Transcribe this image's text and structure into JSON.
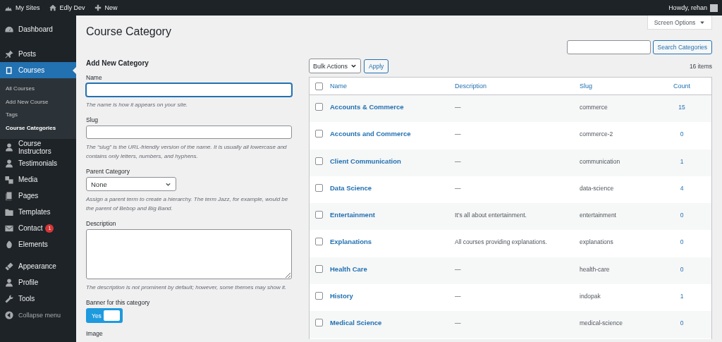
{
  "admin_bar": {
    "items": [
      {
        "label": "My Sites"
      },
      {
        "label": "Edly Dev"
      },
      {
        "label": "New"
      }
    ],
    "greeting": "Howdy, rehan"
  },
  "sidebar": {
    "groups": [
      {
        "items": [
          {
            "label": "Dashboard",
            "selected": false
          }
        ]
      },
      {
        "items": [
          {
            "label": "Posts",
            "selected": false
          },
          {
            "label": "Courses",
            "selected": true,
            "children": [
              {
                "label": "All Courses",
                "selected": false
              },
              {
                "label": "Add New Course",
                "selected": false
              },
              {
                "label": "Tags",
                "selected": false
              },
              {
                "label": "Course Categories",
                "selected": true
              }
            ]
          },
          {
            "label": "Course Instructors",
            "selected": false
          },
          {
            "label": "Testimonials",
            "selected": false
          },
          {
            "label": "Media",
            "selected": false
          },
          {
            "label": "Pages",
            "selected": false
          },
          {
            "label": "Templates",
            "selected": false
          },
          {
            "label": "Contact",
            "selected": false,
            "badge": "1"
          },
          {
            "label": "Elements",
            "selected": false
          }
        ]
      },
      {
        "items": [
          {
            "label": "Appearance",
            "selected": false
          },
          {
            "label": "Profile",
            "selected": false
          },
          {
            "label": "Tools",
            "selected": false
          },
          {
            "label": "Collapse menu",
            "selected": false,
            "kind": "collapse"
          }
        ]
      }
    ]
  },
  "page": {
    "title": "Course Category",
    "screen_options": "Screen Options"
  },
  "form": {
    "heading": "Add New Category",
    "fields": [
      {
        "kind": "text",
        "label": "Name",
        "focused": true,
        "hint": "The name is how it appears on your site."
      },
      {
        "kind": "text",
        "label": "Slug",
        "focused": false,
        "hint": "The “slug” is the URL-friendly version of the name. It is usually all lowercase and contains only letters, numbers, and hyphens."
      },
      {
        "kind": "select",
        "label": "Parent Category",
        "value": "None",
        "hint": "Assign a parent term to create a hierarchy. The term Jazz, for example, would be the parent of Bebop and Big Band."
      },
      {
        "kind": "textarea",
        "label": "Description",
        "hint": "The description is not prominent by default; however, some themes may show it."
      },
      {
        "kind": "toggle",
        "label": "Banner for this category",
        "on": true,
        "value": "Yes"
      },
      {
        "kind": "label",
        "label": "Image"
      }
    ]
  },
  "search": {
    "button": "Search Categories"
  },
  "bulk": {
    "value": "Bulk Actions",
    "apply": "Apply",
    "count": "16 items"
  },
  "table": {
    "select_all_checked": false,
    "columns": [
      "Name",
      "Description",
      "Slug",
      "Count"
    ],
    "rows": [
      {
        "name": "Accounts & Commerce",
        "description": "—",
        "slug": "commerce",
        "count": "15",
        "checked": false
      },
      {
        "name": "Accounts and Commerce",
        "description": "—",
        "slug": "commerce-2",
        "count": "0",
        "checked": false
      },
      {
        "name": "Client Communication",
        "description": "—",
        "slug": "communication",
        "count": "1",
        "checked": false
      },
      {
        "name": "Data Science",
        "description": "—",
        "slug": "data-science",
        "count": "4",
        "checked": false
      },
      {
        "name": "Entertainment",
        "description": "It’s all about entertainment.",
        "slug": "entertainment",
        "count": "0",
        "checked": false
      },
      {
        "name": "Explanations",
        "description": "All courses providing explanations.",
        "slug": "explanations",
        "count": "0",
        "checked": false
      },
      {
        "name": "Health Care",
        "description": "—",
        "slug": "health-care",
        "count": "0",
        "checked": false
      },
      {
        "name": "History",
        "description": "—",
        "slug": "indopak",
        "count": "1",
        "checked": false
      },
      {
        "name": "Medical Science",
        "description": "—",
        "slug": "medical-science",
        "count": "0",
        "checked": false
      }
    ]
  }
}
